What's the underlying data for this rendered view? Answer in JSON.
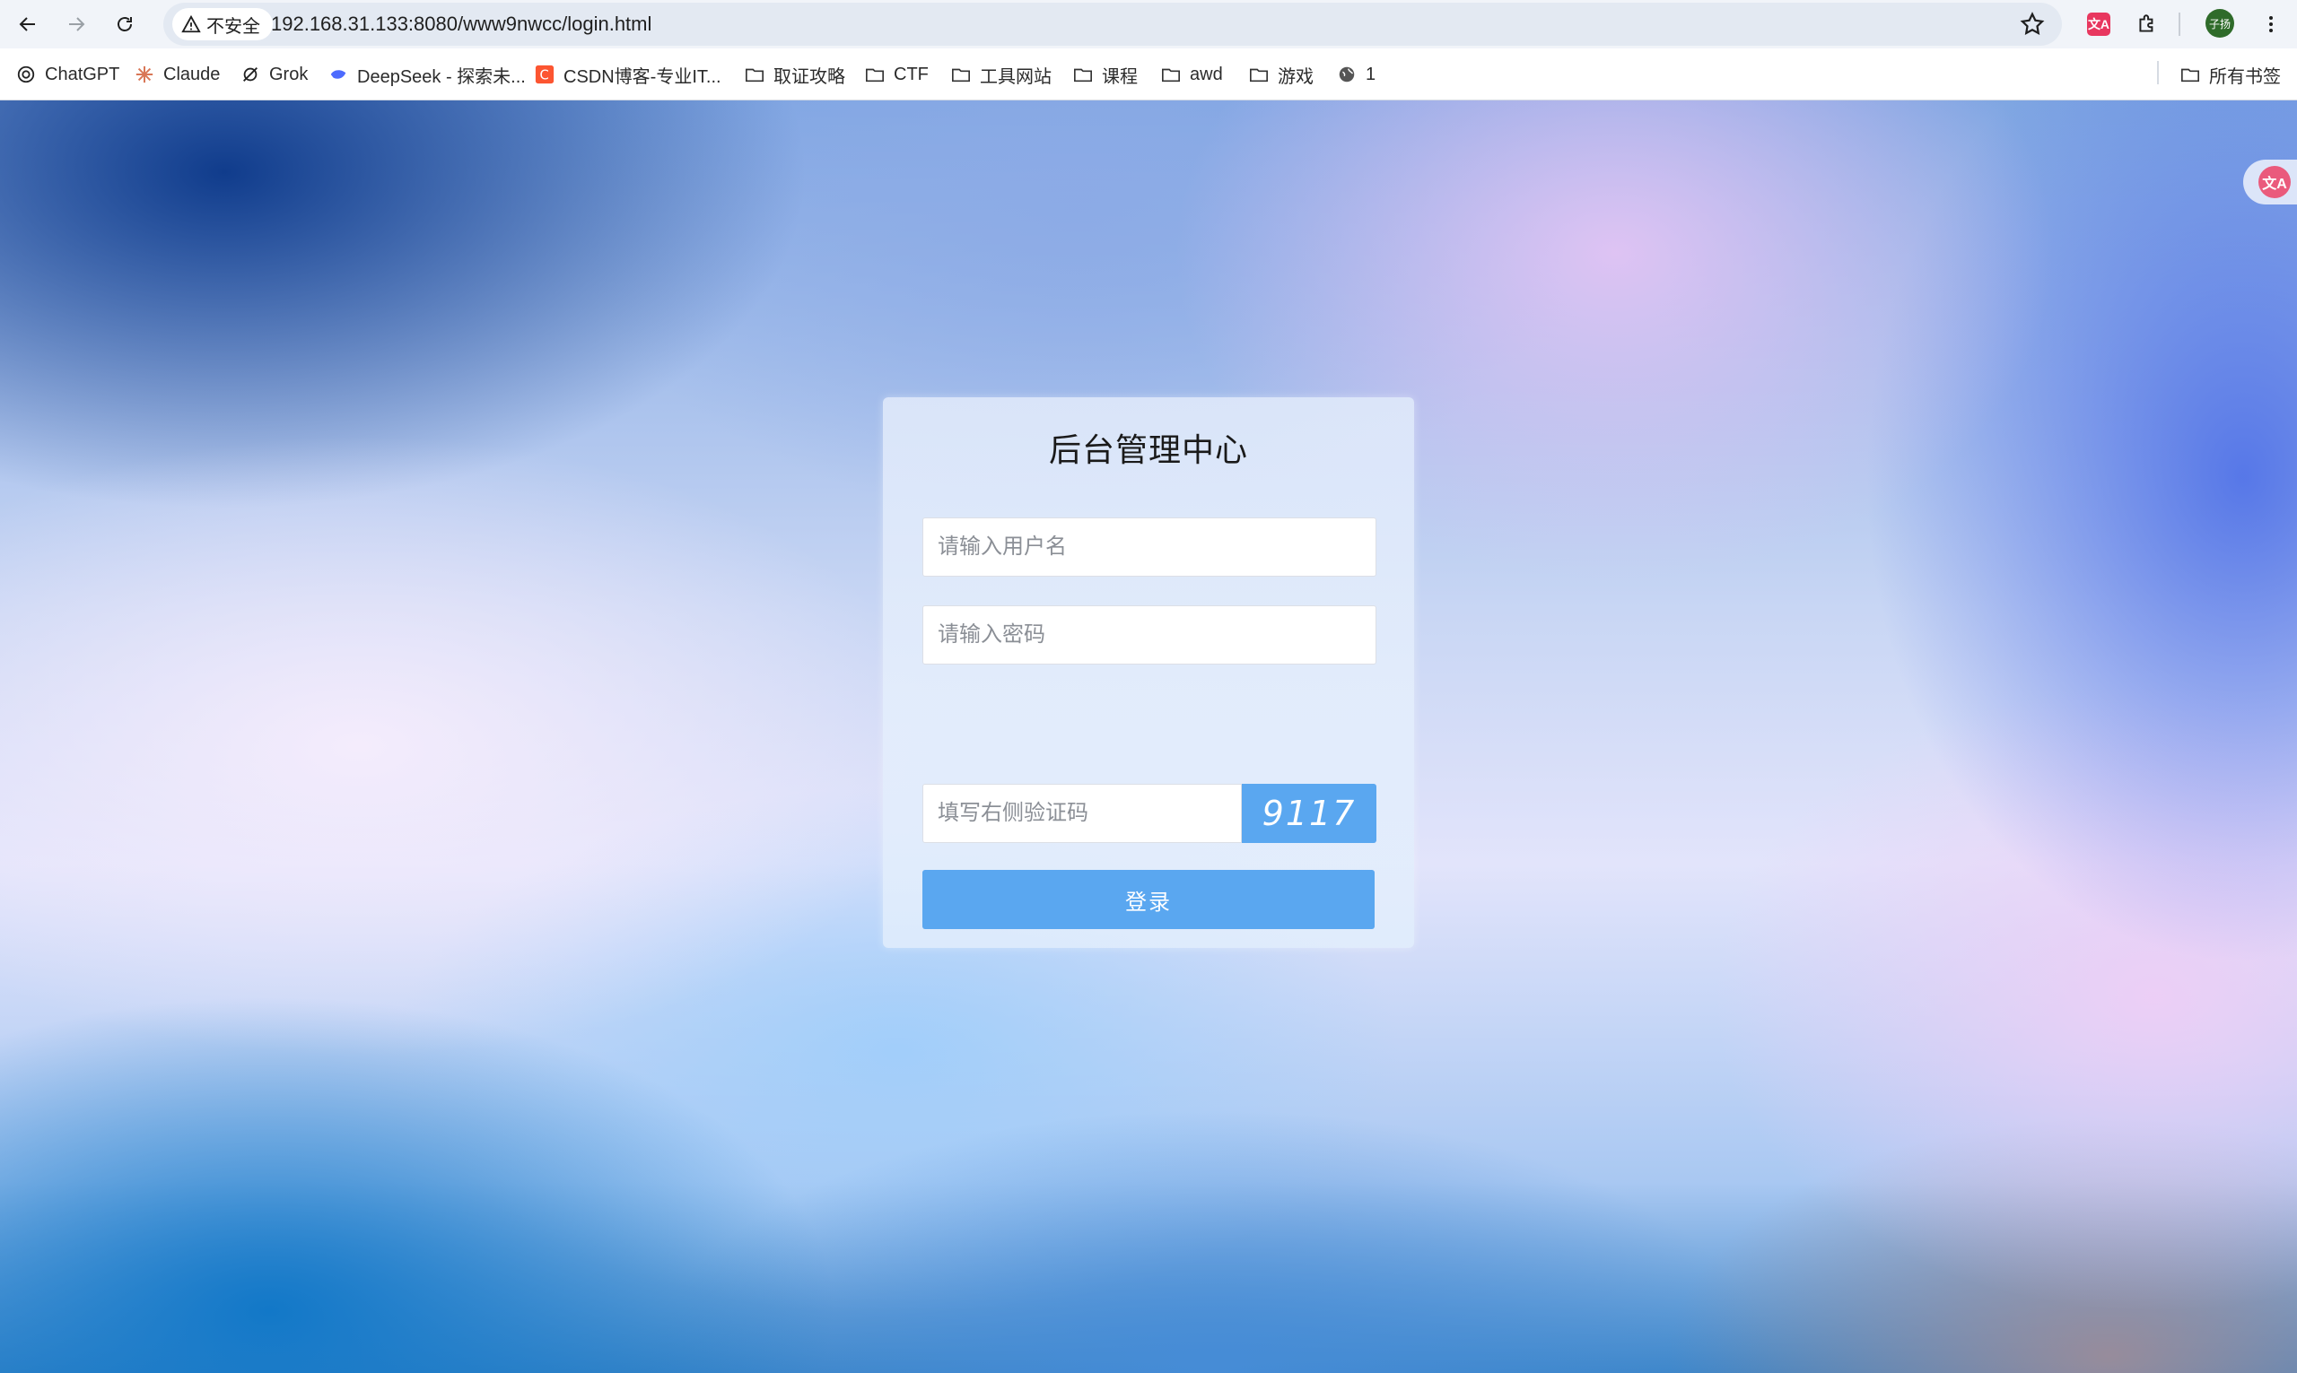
{
  "browser": {
    "security_label": "不安全",
    "url": "192.168.31.133:8080/www9nwcc/login.html",
    "avatar_text": "子扬",
    "translate_ext_text": "文A"
  },
  "bookmarks": {
    "items": [
      {
        "label": "ChatGPT",
        "icon": "chatgpt-icon"
      },
      {
        "label": "Claude",
        "icon": "claude-icon"
      },
      {
        "label": "Grok",
        "icon": "grok-icon"
      },
      {
        "label": "DeepSeek - 探索未...",
        "icon": "deepseek-icon"
      },
      {
        "label": "CSDN博客-专业IT...",
        "icon": "csdn-icon"
      },
      {
        "label": "取证攻略",
        "icon": "folder-icon"
      },
      {
        "label": "CTF",
        "icon": "folder-icon"
      },
      {
        "label": "工具网站",
        "icon": "folder-icon"
      },
      {
        "label": "课程",
        "icon": "folder-icon"
      },
      {
        "label": "awd",
        "icon": "folder-icon"
      },
      {
        "label": "游戏",
        "icon": "folder-icon"
      },
      {
        "label": "1",
        "icon": "globe-icon"
      }
    ],
    "all_bookmarks_label": "所有书签"
  },
  "login": {
    "title": "后台管理中心",
    "username_placeholder": "请输入用户名",
    "password_placeholder": "请输入密码",
    "captcha_placeholder": "填写右侧验证码",
    "captcha_code": "9117",
    "submit_label": "登录"
  },
  "colors": {
    "accent": "#5aa7f0",
    "translate_ext": "#e8375f"
  }
}
